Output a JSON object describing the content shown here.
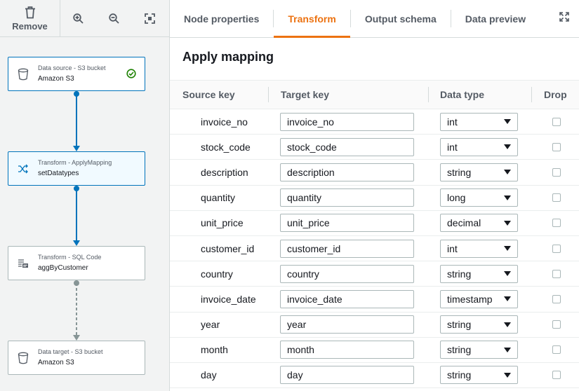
{
  "toolbar": {
    "remove_label": "Remove",
    "zoom_in_icon": "zoom-in-icon",
    "zoom_out_icon": "zoom-out-icon",
    "fit_icon": "fit-view-icon"
  },
  "nodes": [
    {
      "type": "Data source - S3 bucket",
      "name": "Amazon S3",
      "icon": "bucket-icon",
      "status": "check-circle-icon"
    },
    {
      "type": "Transform - ApplyMapping",
      "name": "setDatatypes",
      "icon": "shuffle-icon"
    },
    {
      "type": "Transform - SQL Code",
      "name": "aggByCustomer",
      "icon": "sql-icon"
    },
    {
      "type": "Data target - S3 bucket",
      "name": "Amazon S3",
      "icon": "bucket-icon"
    }
  ],
  "tabs": [
    {
      "label": "Node properties"
    },
    {
      "label": "Transform",
      "active": true
    },
    {
      "label": "Output schema"
    },
    {
      "label": "Data preview"
    }
  ],
  "panel": {
    "title": "Apply mapping"
  },
  "table": {
    "headers": [
      "Source key",
      "Target key",
      "Data type",
      "Drop"
    ],
    "rows": [
      {
        "source": "invoice_no",
        "target": "invoice_no",
        "type": "int"
      },
      {
        "source": "stock_code",
        "target": "stock_code",
        "type": "int"
      },
      {
        "source": "description",
        "target": "description",
        "type": "string"
      },
      {
        "source": "quantity",
        "target": "quantity",
        "type": "long"
      },
      {
        "source": "unit_price",
        "target": "unit_price",
        "type": "decimal"
      },
      {
        "source": "customer_id",
        "target": "customer_id",
        "type": "int"
      },
      {
        "source": "country",
        "target": "country",
        "type": "string"
      },
      {
        "source": "invoice_date",
        "target": "invoice_date",
        "type": "timestamp"
      },
      {
        "source": "year",
        "target": "year",
        "type": "string"
      },
      {
        "source": "month",
        "target": "month",
        "type": "string"
      },
      {
        "source": "day",
        "target": "day",
        "type": "string"
      }
    ]
  },
  "colors": {
    "accent": "#ec7211",
    "edge": "#0073bb",
    "edge_pending": "#879596",
    "success": "#1d8102"
  }
}
